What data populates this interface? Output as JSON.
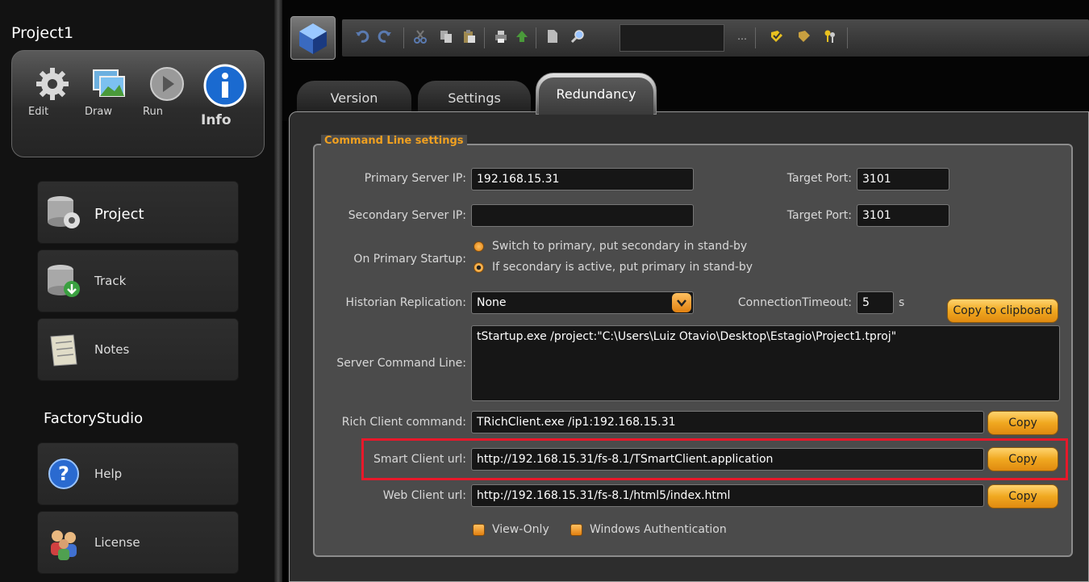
{
  "sidebar": {
    "project_title": "Project1",
    "modes": [
      {
        "label": "Edit",
        "icon": "gear-icon"
      },
      {
        "label": "Draw",
        "icon": "picture-icon"
      },
      {
        "label": "Run",
        "icon": "play-icon"
      },
      {
        "label": "Info",
        "icon": "info-icon"
      }
    ],
    "items": [
      {
        "label": "Project",
        "icon": "database-gear-icon"
      },
      {
        "label": "Track",
        "icon": "database-download-icon"
      },
      {
        "label": "Notes",
        "icon": "notepad-icon"
      }
    ],
    "factory_title": "FactoryStudio",
    "items2": [
      {
        "label": "Help",
        "icon": "help-icon"
      },
      {
        "label": "License",
        "icon": "users-icon"
      }
    ]
  },
  "tabs": [
    "Version",
    "Settings",
    "Redundancy"
  ],
  "group_title": "Command Line settings",
  "form": {
    "primary_ip_label": "Primary Server IP:",
    "primary_ip_value": "192.168.15.31",
    "secondary_ip_label": "Secondary Server IP:",
    "secondary_ip_value": "",
    "target_port_label": "Target Port:",
    "target_port1": "3101",
    "target_port2": "3101",
    "startup_label": "On Primary Startup:",
    "startup_opt1": "Switch to primary, put secondary in stand-by",
    "startup_opt2": "If secondary is active, put primary in stand-by",
    "historian_label": "Historian Replication:",
    "historian_value": "None",
    "timeout_label": "ConnectionTimeout:",
    "timeout_value": "5",
    "timeout_unit": "s",
    "copy_clipboard": "Copy to clipboard",
    "server_cmd_label": "Server Command Line:",
    "server_cmd_value": "tStartup.exe /project:\"C:\\Users\\Luiz Otavio\\Desktop\\Estagio\\Project1.tproj\"",
    "rich_label": "Rich Client command:",
    "rich_value": "TRichClient.exe  /ip1:192.168.15.31",
    "smart_label": "Smart Client url:",
    "smart_value": "http://192.168.15.31/fs-8.1/TSmartClient.application",
    "web_label": "Web Client url:",
    "web_value": "http://192.168.15.31/fs-8.1/html5/index.html",
    "copy": "Copy",
    "view_only": "View-Only",
    "windows_auth": "Windows Authentication"
  },
  "colors": {
    "accent": "#f0a020",
    "highlight": "#e8182a"
  }
}
